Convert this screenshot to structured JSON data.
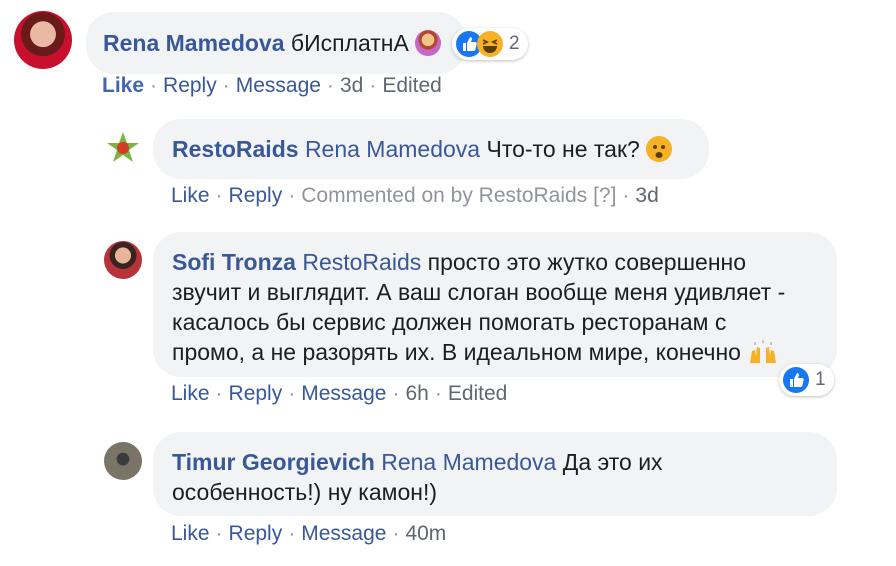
{
  "comments": [
    {
      "author": "Rena Mamedova",
      "text": "бИсплатнА",
      "reaction_count": "2",
      "actions": {
        "like": "Like",
        "reply": "Reply",
        "message": "Message",
        "time": "3d",
        "edited": "Edited"
      }
    },
    {
      "author": "RestoRaids",
      "mention": "Rena Mamedova",
      "text": "Что-то не так?",
      "actions": {
        "like": "Like",
        "reply": "Reply",
        "commented_on": "Commented on by RestoRaids",
        "help": "[?]",
        "time": "3d"
      }
    },
    {
      "author": "Sofi Tronza",
      "mention": "RestoRaids",
      "text_line1": "просто это жутко совершенно",
      "text_line2": "звучит и выглядит. А ваш слоган вообще меня удивляет -",
      "text_line3": "касалось бы сервис должен помогать ресторанам с",
      "text_line4": "промо, а не разорять их. В идеальном мире, конечно",
      "reaction_count": "1",
      "actions": {
        "like": "Like",
        "reply": "Reply",
        "message": "Message",
        "time": "6h",
        "edited": "Edited"
      }
    },
    {
      "author": "Timur Georgievich",
      "mention": "Rena Mamedova",
      "text_line1": "Да это их",
      "text_line2": "особенность!) ну камон!)",
      "actions": {
        "like": "Like",
        "reply": "Reply",
        "message": "Message",
        "time": "40m"
      }
    }
  ],
  "icons": {
    "reaction_like": "thumbs-up-icon",
    "reaction_haha": "laughing-emoji-icon",
    "emoji_facepalm": "woman-facepalming-emoji-icon",
    "emoji_worried": "frowning-emoji-icon",
    "emoji_praise": "raising-hands-emoji-icon"
  },
  "colors": {
    "link": "#385898",
    "bubble": "#f2f3f5",
    "like_blue": "#4267b2",
    "meta": "#606770"
  }
}
